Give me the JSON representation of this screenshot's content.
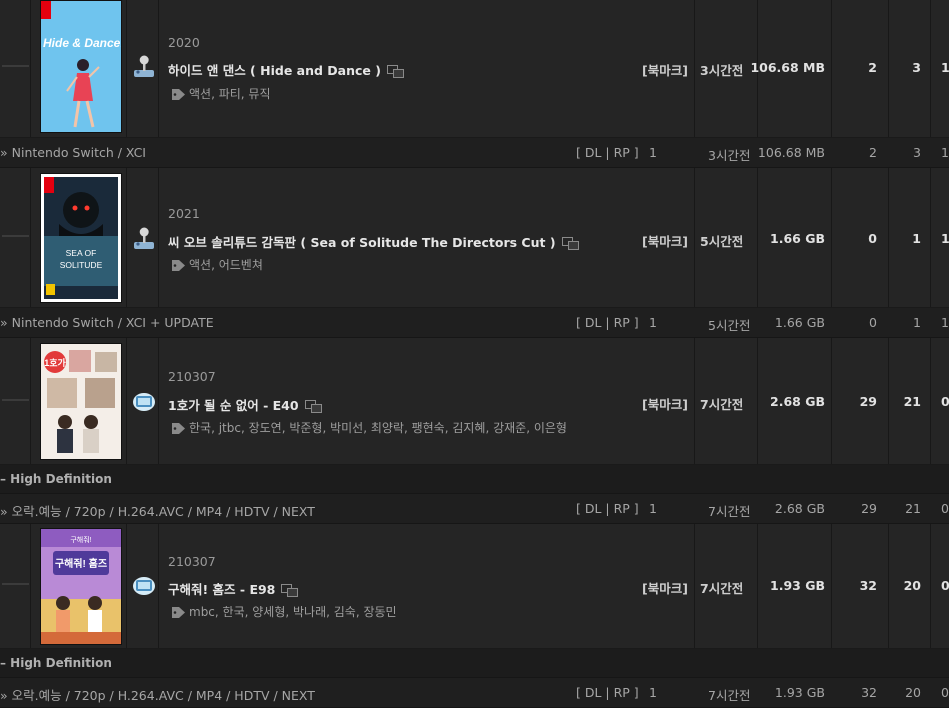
{
  "rows": [
    {
      "year": "2020",
      "title": "하이드 앤 댄스 ( Hide and Dance )",
      "tags": "액션, 파티, 뮤직",
      "bookmark": "[북마크]",
      "time": "3시간전",
      "size": "106.68 MB",
      "c1": "2",
      "c2": "3",
      "c3": "1",
      "cover_text": "Hide & Dance!",
      "cat_icon": "joystick-icon",
      "sub": {
        "path": "» Nintendo Switch / XCI",
        "dlrp": "[ DL | RP ]",
        "count": "1",
        "time": "3시간전",
        "size": "106.68 MB",
        "c1": "2",
        "c2": "3",
        "c3": "1"
      }
    },
    {
      "year": "2021",
      "title": "씨 오브 솔리튜드 감독판 ( Sea of Solitude The Directors Cut )",
      "tags": "액션, 어드벤쳐",
      "bookmark": "[북마크]",
      "time": "5시간전",
      "size": "1.66 GB",
      "c1": "0",
      "c2": "1",
      "c3": "1",
      "cover_text": "SEA OF SOLITUDE",
      "cat_icon": "joystick-icon",
      "sub": {
        "path": "» Nintendo Switch / XCI + UPDATE",
        "dlrp": "[ DL | RP ]",
        "count": "1",
        "time": "5시간전",
        "size": "1.66 GB",
        "c1": "0",
        "c2": "1",
        "c3": "1"
      }
    },
    {
      "year": "210307",
      "title": "1호가 될 순 없어 - E40",
      "tags": "한국, jtbc, 장도연, 박준형, 박미선, 최양락, 팽현숙, 김지혜, 강재준, 이은형",
      "bookmark": "[북마크]",
      "time": "7시간전",
      "size": "2.68 GB",
      "c1": "29",
      "c2": "21",
      "c3": "0",
      "cover_text": "1호가",
      "cat_icon": "tv-icon",
      "hd_label": "– High Definition",
      "sub": {
        "path": "» 오락.예능 / 720p / H.264.AVC / MP4 / HDTV / NEXT",
        "dlrp": "[ DL | RP ]",
        "count": "1",
        "time": "7시간전",
        "size": "2.68 GB",
        "c1": "29",
        "c2": "21",
        "c3": "0"
      }
    },
    {
      "year": "210307",
      "title": "구해줘! 홈즈 - E98",
      "tags": "mbc, 한국, 양세형, 박나래, 김숙, 장동민",
      "bookmark": "[북마크]",
      "time": "7시간전",
      "size": "1.93 GB",
      "c1": "32",
      "c2": "20",
      "c3": "0",
      "cover_text": "구해줘! 홈즈",
      "cat_icon": "tv-icon",
      "hd_label": "– High Definition",
      "sub": {
        "path": "» 오락.예능 / 720p / H.264.AVC / MP4 / HDTV / NEXT",
        "dlrp": "[ DL | RP ]",
        "count": "1",
        "time": "7시간전",
        "size": "1.93 GB",
        "c1": "32",
        "c2": "20",
        "c3": "0"
      }
    }
  ],
  "colors": {
    "background": "#232323",
    "row": "#252525",
    "subrow": "#1f1f1f",
    "text": "#c8c8c8"
  }
}
